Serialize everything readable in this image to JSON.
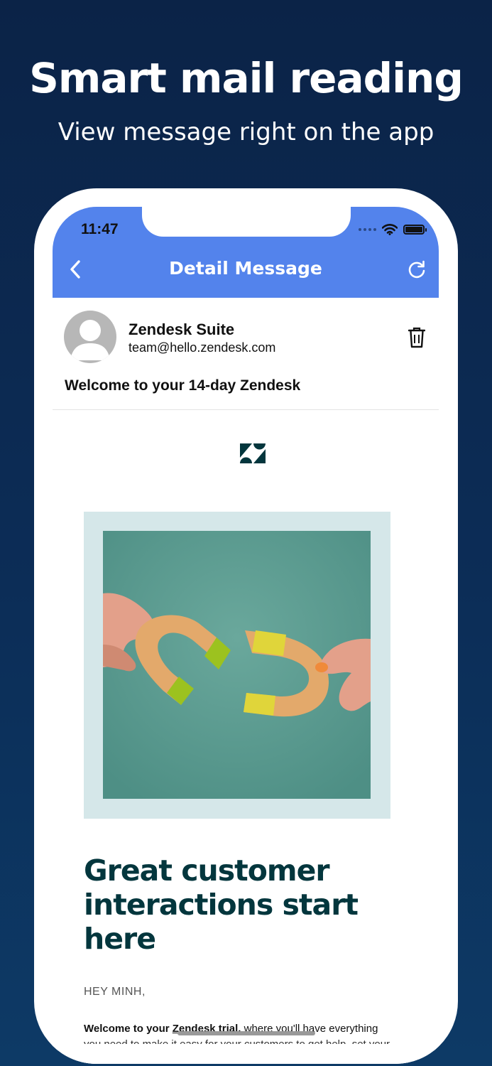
{
  "promo": {
    "title": "Smart mail reading",
    "subtitle": "View message right on the app"
  },
  "status_bar": {
    "time": "11:47",
    "icons": [
      "signal-dots-icon",
      "wifi-icon",
      "battery-icon"
    ]
  },
  "header": {
    "title": "Detail Message",
    "back_icon": "chevron-left-icon",
    "refresh_icon": "refresh-icon",
    "background_color": "#5383ec"
  },
  "message": {
    "sender_name": "Zendesk Suite",
    "sender_email": "team@hello.zendesk.com",
    "subject": "Welcome to your 14-day Zendesk",
    "delete_icon": "trash-icon"
  },
  "email_body": {
    "logo_icon": "zendesk-logo-icon",
    "headline": "Great customer interactions start here",
    "greeting": "HEY MINH,",
    "welcome_prefix": "Welcome to your",
    "welcome_link": "Zendesk trial,",
    "welcome_rest": " where you'll have everything",
    "welcome_line2": "you need to make it easy for your customers to get help, set your",
    "headline_color": "#03363d"
  }
}
